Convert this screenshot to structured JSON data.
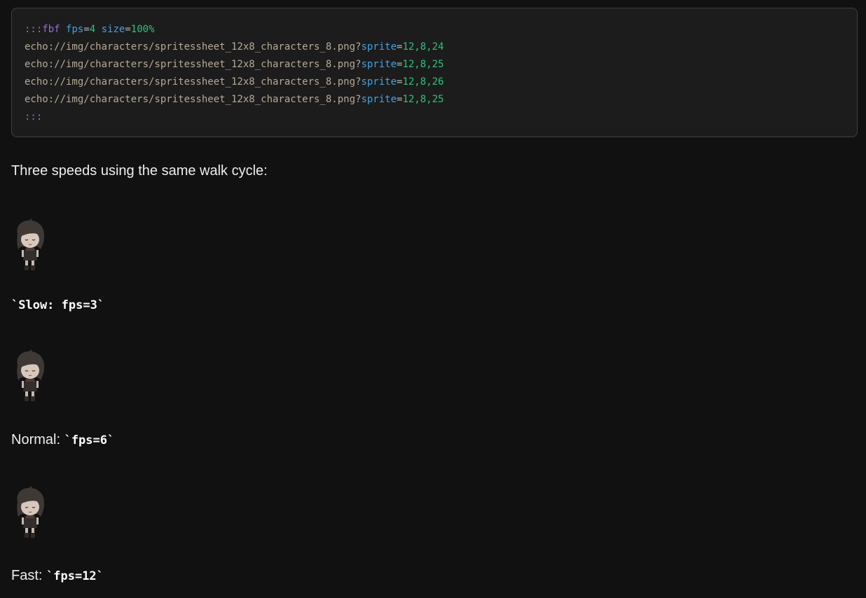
{
  "code_block": {
    "fence_open": ":::",
    "directive": "fbf",
    "params": [
      {
        "key": "fps",
        "value": "4"
      },
      {
        "key": "size",
        "value": "100%"
      }
    ],
    "lines": [
      {
        "url": "echo://img/characters/spritessheet_12x8_characters_8.png?",
        "key": "sprite",
        "value": "12,8,24"
      },
      {
        "url": "echo://img/characters/spritessheet_12x8_characters_8.png?",
        "key": "sprite",
        "value": "12,8,25"
      },
      {
        "url": "echo://img/characters/spritessheet_12x8_characters_8.png?",
        "key": "sprite",
        "value": "12,8,26"
      },
      {
        "url": "echo://img/characters/spritessheet_12x8_characters_8.png?",
        "key": "sprite",
        "value": "12,8,25"
      }
    ],
    "fence_close": ":::"
  },
  "intro_text": "Three speeds using the same walk cycle:",
  "speeds": {
    "slow": {
      "label": "",
      "code": "`Slow: fps=3`"
    },
    "normal": {
      "label": "Normal: ",
      "code": "`fps=6`"
    },
    "fast": {
      "label": "Fast: ",
      "code": "`fps=12`"
    }
  },
  "colors": {
    "background": "#111111",
    "code_background": "#1c1c1c",
    "fence": "#9b6bd6",
    "key": "#3ea3e6",
    "value": "#2ec27e",
    "url": "#b4aa98"
  }
}
